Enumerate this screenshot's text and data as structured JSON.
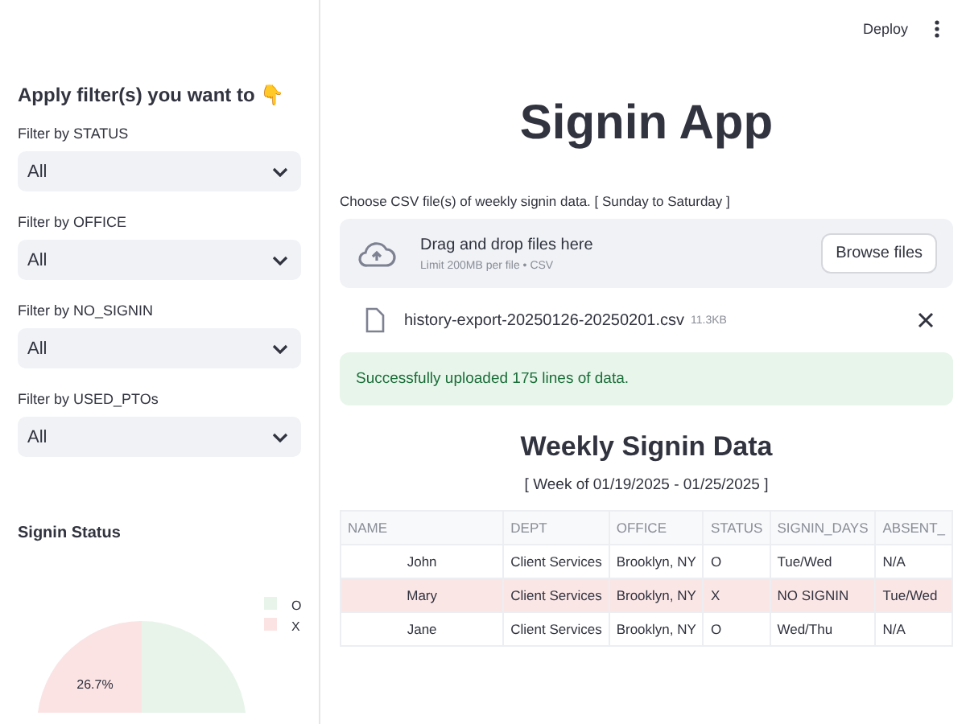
{
  "header": {
    "deploy": "Deploy"
  },
  "sidebar": {
    "heading": "Apply filter(s) you want to",
    "heading_emoji": "👇",
    "filters": [
      {
        "label": "Filter by STATUS",
        "value": "All"
      },
      {
        "label": "Filter by OFFICE",
        "value": "All"
      },
      {
        "label": "Filter by NO_SIGNIN",
        "value": "All"
      },
      {
        "label": "Filter by USED_PTOs",
        "value": "All"
      }
    ],
    "chart_title": "Signin Status",
    "chart_data": {
      "type": "pie",
      "legend": "top-right",
      "categories": [
        "O",
        "X"
      ],
      "values": [
        73.3,
        26.7
      ],
      "value_labels": [
        null,
        "26.7%"
      ]
    }
  },
  "main": {
    "title": "Signin App",
    "uploader_label": "Choose CSV file(s) of weekly signin data. [ Sunday to Saturday ]",
    "dropzone": {
      "title": "Drag and drop files here",
      "hint": "Limit 200MB per file • CSV",
      "button": "Browse files"
    },
    "file": {
      "name": "history-export-20250126-20250201.csv",
      "size": "11.3KB"
    },
    "success": "Successfully uploaded 175 lines of data.",
    "table_title": "Weekly Signin Data",
    "table_subtitle": "[ Week of 01/19/2025 - 01/25/2025 ]",
    "table": {
      "columns": [
        "NAME",
        "DEPT",
        "OFFICE",
        "STATUS",
        "SIGNIN_DAYS",
        "ABSENT_"
      ],
      "rows": [
        {
          "cells": [
            "John",
            "Client Services",
            "Brooklyn, NY",
            "O",
            "Tue/Wed",
            "N/A"
          ],
          "highlighted": false
        },
        {
          "cells": [
            "Mary",
            "Client Services",
            "Brooklyn, NY",
            "X",
            "NO SIGNIN",
            "Tue/Wed"
          ],
          "highlighted": true
        },
        {
          "cells": [
            "Jane",
            "Client Services",
            "Brooklyn, NY",
            "O",
            "Wed/Thu",
            "N/A"
          ],
          "highlighted": false
        }
      ]
    }
  }
}
